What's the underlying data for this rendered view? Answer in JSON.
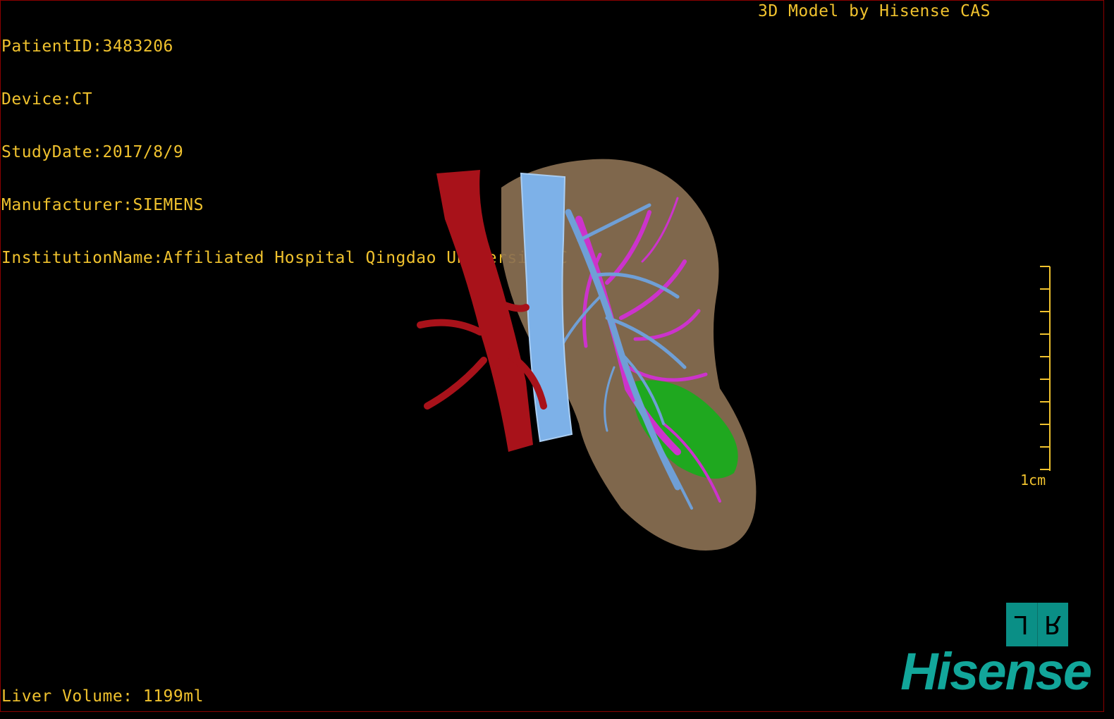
{
  "info": {
    "patient_id": "PatientID:3483206",
    "device": "Device:CT",
    "study_date": "StudyDate:2017/8/9",
    "manufacturer": "Manufacturer:SIEMENS",
    "institution": "InstitutionName:Affiliated Hospital Qingdao University-C"
  },
  "credit": "3D Model by Hisense CAS",
  "liver_volume": "Liver Volume: 1199ml",
  "scale_label": "1cm",
  "orientation": {
    "left": "L",
    "right": "R"
  },
  "brand": "Hisense",
  "colors": {
    "overlay_text": "#f0c22e",
    "liver": "#8a7052",
    "aorta": "#a8121a",
    "vena_cava": "#7db1e8",
    "portal_vein": "#cc33cc",
    "hepatic_vein": "#6f9fd6",
    "lesion": "#1fa81f",
    "brand": "#12a69a"
  }
}
